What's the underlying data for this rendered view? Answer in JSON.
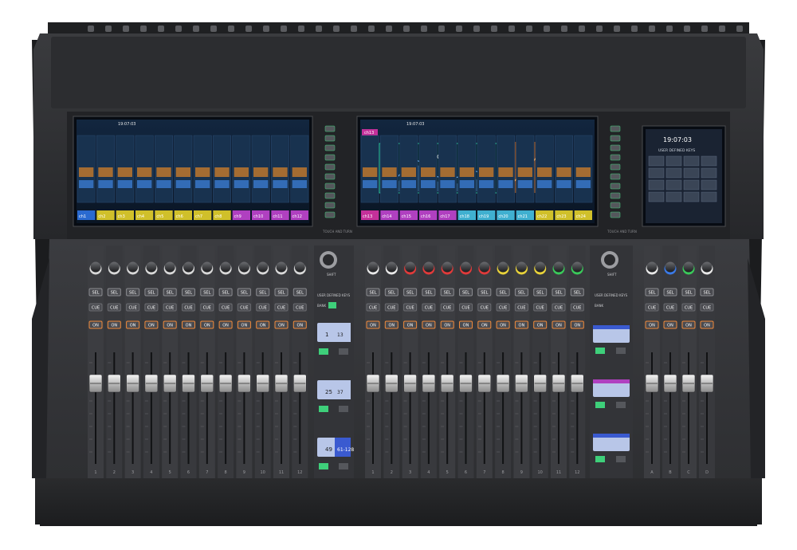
{
  "console": {
    "left_screen": {
      "header": "19:07:03",
      "channels": [
        "ch1",
        "ch2",
        "ch3",
        "ch4",
        "ch5",
        "ch6",
        "ch7",
        "ch8",
        "ch9",
        "ch10",
        "ch11",
        "ch12"
      ]
    },
    "center_screen": {
      "header": "19:07:03",
      "selected_channel": "ch13",
      "eq_title": "ch13",
      "channels": [
        "ch13",
        "ch14",
        "ch15",
        "ch16",
        "ch17",
        "ch18",
        "ch19",
        "ch20",
        "ch21",
        "ch22",
        "ch23",
        "ch24"
      ]
    },
    "right_screen": {
      "clock": "19:07:03",
      "title": "USER DEFINED KEYS"
    },
    "bay_labels": {
      "left": "TOUCH AND TURN",
      "center": "TOUCH AND TURN"
    },
    "strip_buttons": {
      "sel": "SEL",
      "cue": "CUE",
      "on": "ON"
    },
    "left_strip_numbers": [
      "1",
      "2",
      "3",
      "4",
      "5",
      "6",
      "7",
      "8",
      "9",
      "10",
      "11",
      "12"
    ],
    "center_strip_numbers": [
      "1",
      "2",
      "3",
      "4",
      "5",
      "6",
      "7",
      "8",
      "9",
      "10",
      "11",
      "12"
    ],
    "right_strip_numbers": [
      "A",
      "B",
      "C",
      "D"
    ],
    "center_section": {
      "shift_label": "SHIFT",
      "user_defined_label": "USER DEFINED KEYS",
      "bank_label": "BANK",
      "displays": [
        {
          "left": "1",
          "right": "13"
        },
        {
          "left": "25",
          "right": "37"
        },
        {
          "left": "49",
          "right": "61-128"
        }
      ]
    },
    "right_section": {
      "shift_label": "SHIFT",
      "user_defined_label": "USER DEFINED KEYS",
      "bank_label": "BANK"
    },
    "colors": {
      "chassis": "#2b2c2e",
      "panel": "#3a3b3e",
      "screen_bg": "#0e1a2a",
      "sel_green": "#3ecf7a",
      "on_orange": "#f08a3a",
      "knob_red": "#e03a3a",
      "knob_yellow": "#e8d23a",
      "knob_green": "#3ac95a",
      "knob_blue": "#3a7ae8",
      "knob_white": "#e8e8e8"
    },
    "knob_rings_center": [
      "white",
      "white",
      "red",
      "red",
      "red",
      "red",
      "red",
      "yellow",
      "yellow",
      "yellow",
      "green",
      "green",
      "green"
    ],
    "knob_rings_right": [
      "white",
      "blue",
      "green",
      "white"
    ]
  }
}
